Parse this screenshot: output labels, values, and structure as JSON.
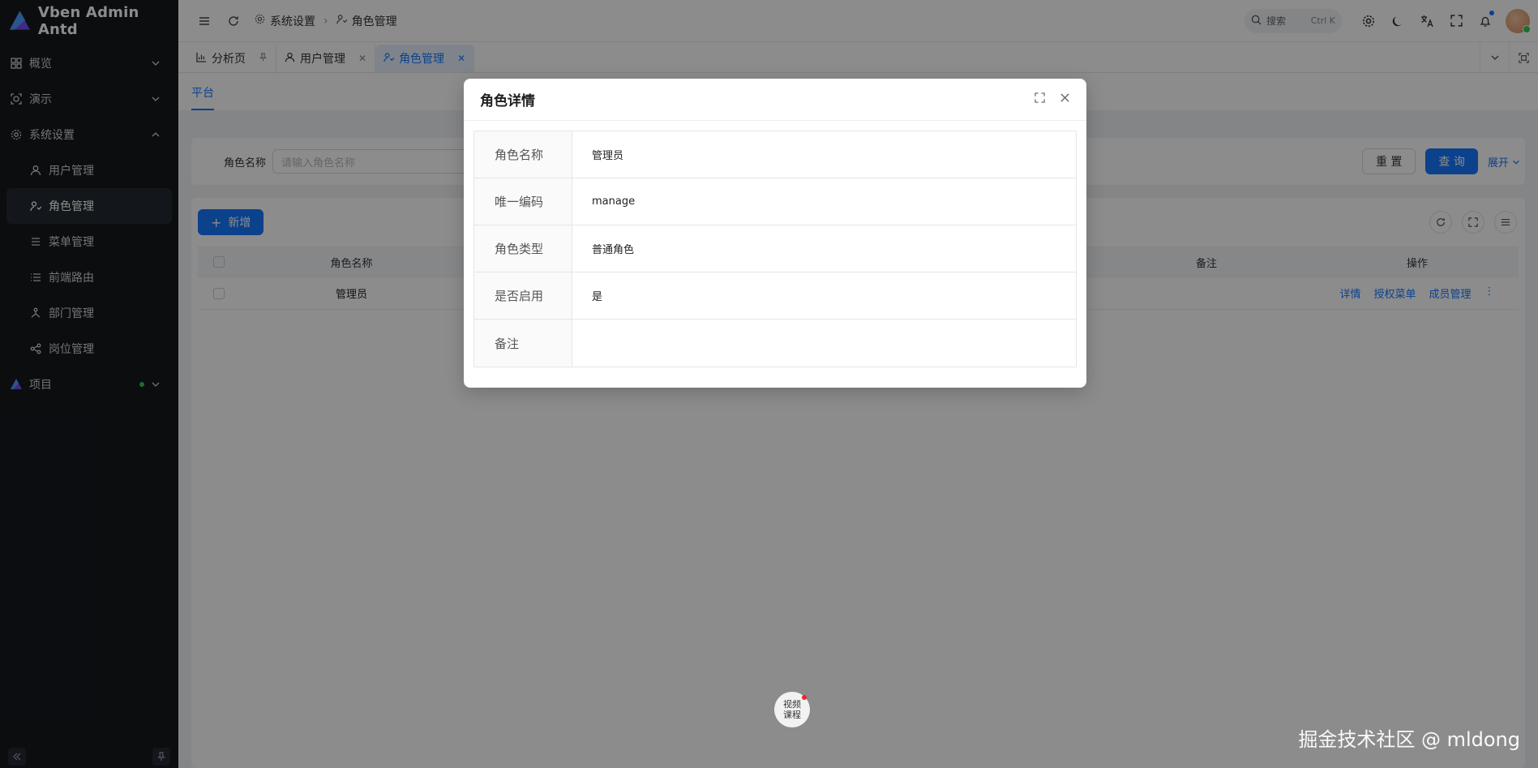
{
  "app": {
    "title": "Vben Admin Antd"
  },
  "sidebar": {
    "items": [
      {
        "label": "概览",
        "icon": "grid-icon",
        "expand": "down"
      },
      {
        "label": "演示",
        "icon": "target-icon",
        "expand": "down"
      },
      {
        "label": "系统设置",
        "icon": "gear-icon",
        "expand": "up"
      },
      {
        "label": "用户管理",
        "icon": "user-icon"
      },
      {
        "label": "角色管理",
        "icon": "role-icon"
      },
      {
        "label": "菜单管理",
        "icon": "menu-icon"
      },
      {
        "label": "前端路由",
        "icon": "list-icon"
      },
      {
        "label": "部门管理",
        "icon": "org-icon"
      },
      {
        "label": "岗位管理",
        "icon": "share-icon"
      },
      {
        "label": "项目",
        "icon": "logo-icon",
        "expand": "down"
      }
    ]
  },
  "header": {
    "breadcrumb": [
      "系统设置",
      "角色管理"
    ],
    "search_placeholder": "搜索",
    "search_shortcut": "Ctrl K"
  },
  "tabs": [
    {
      "label": "分析页",
      "icon": "chart-icon",
      "pinned": true
    },
    {
      "label": "用户管理",
      "icon": "user-icon"
    },
    {
      "label": "角色管理",
      "icon": "role-icon",
      "active": true
    }
  ],
  "subtab": {
    "label": "平台"
  },
  "search_form": {
    "field_label": "角色名称",
    "field_placeholder": "请输入角色名称",
    "reset_label": "重 置",
    "query_label": "查 询",
    "expand_label": "展开"
  },
  "table": {
    "add_label": "新增",
    "columns": [
      "角色名称",
      "备注",
      "操作"
    ],
    "rows": [
      {
        "name": "管理员",
        "remark": "",
        "actions": [
          "详情",
          "授权菜单",
          "成员管理"
        ]
      }
    ]
  },
  "modal": {
    "title": "角色详情",
    "fields": [
      {
        "label": "角色名称",
        "value": "管理员"
      },
      {
        "label": "唯一编码",
        "value": "manage"
      },
      {
        "label": "角色类型",
        "value": "普通角色"
      },
      {
        "label": "是否启用",
        "value": "是"
      },
      {
        "label": "备注",
        "value": ""
      }
    ]
  },
  "float_button": {
    "line1": "视频",
    "line2": "课程"
  },
  "watermark": "掘金技术社区 @ mldong",
  "colors": {
    "sidebar_bg": "#14181d",
    "accent": "#1677ff",
    "status_online": "#34c759"
  }
}
